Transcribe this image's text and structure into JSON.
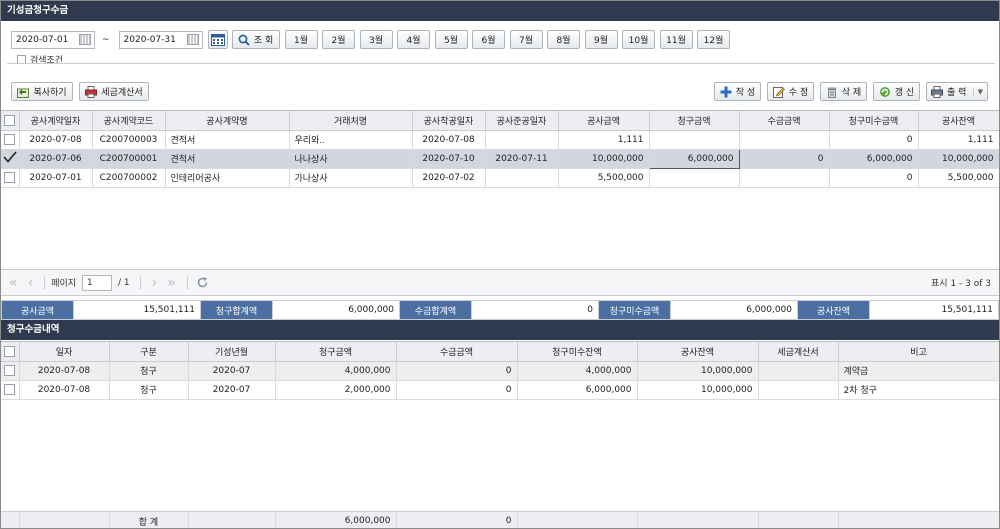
{
  "top_panel": {
    "title": "기성금청구수금"
  },
  "filter": {
    "date_from": "2020-07-01",
    "date_sep": "~",
    "date_to": "2020-07-31",
    "search_label": "조 회",
    "months": [
      "1월",
      "2월",
      "3월",
      "4월",
      "5월",
      "6월",
      "7월",
      "8월",
      "9월",
      "10월",
      "11월",
      "12월"
    ],
    "search_condition_label": "검색조건"
  },
  "toolbar": {
    "copy_label": "복사하기",
    "tax_invoice_label": "세금계산서",
    "create_label": "작 성",
    "edit_label": "수 정",
    "delete_label": "삭 제",
    "refresh_label": "갱 신",
    "print_label": "출 력"
  },
  "main_grid": {
    "columns": [
      "공사계약일자",
      "공사계약코드",
      "공사계약명",
      "거래처명",
      "공사착공일자",
      "공사준공일자",
      "공사금액",
      "청구금액",
      "수금금액",
      "청구미수금액",
      "공사잔액"
    ],
    "rows": [
      {
        "selected": false,
        "cells": [
          "2020-07-08",
          "C200700003",
          "견적서",
          "우리와..",
          "2020-07-08",
          "",
          "1,111",
          "",
          "",
          "0",
          "1,111"
        ]
      },
      {
        "selected": true,
        "cells": [
          "2020-07-06",
          "C200700001",
          "견적서",
          "나나상사",
          "2020-07-10",
          "2020-07-11",
          "10,000,000",
          "6,000,000",
          "0",
          "6,000,000",
          "10,000,000"
        ]
      },
      {
        "selected": false,
        "cells": [
          "2020-07-01",
          "C200700002",
          "인테리어공사",
          "가나상사",
          "2020-07-02",
          "",
          "5,500,000",
          "",
          "",
          "0",
          "5,500,000"
        ]
      }
    ]
  },
  "pager": {
    "page_label": "페이지",
    "page_value": "1",
    "page_total": "/ 1",
    "display_info": "표시 1 - 3 of 3"
  },
  "summary": [
    {
      "label": "공사금액",
      "value": "15,501,111"
    },
    {
      "label": "청구합계액",
      "value": "6,000,000"
    },
    {
      "label": "수금합계액",
      "value": "0"
    },
    {
      "label": "청구미수금액",
      "value": "6,000,000"
    },
    {
      "label": "공사잔액",
      "value": "15,501,111"
    }
  ],
  "bottom_panel": {
    "title": "청구수금내역"
  },
  "detail_grid": {
    "columns": [
      "일자",
      "구분",
      "기성년월",
      "청구금액",
      "수금금액",
      "청구미수잔액",
      "공사잔액",
      "세금계산서",
      "비고"
    ],
    "rows": [
      {
        "cells": [
          "2020-07-08",
          "청구",
          "2020-07",
          "4,000,000",
          "0",
          "4,000,000",
          "10,000,000",
          "",
          "계약금"
        ]
      },
      {
        "cells": [
          "2020-07-08",
          "청구",
          "2020-07",
          "2,000,000",
          "0",
          "6,000,000",
          "10,000,000",
          "",
          "2차 청구"
        ]
      }
    ],
    "total": {
      "label": "합 계",
      "claim_total": "6,000,000",
      "collect_total": "0"
    }
  }
}
